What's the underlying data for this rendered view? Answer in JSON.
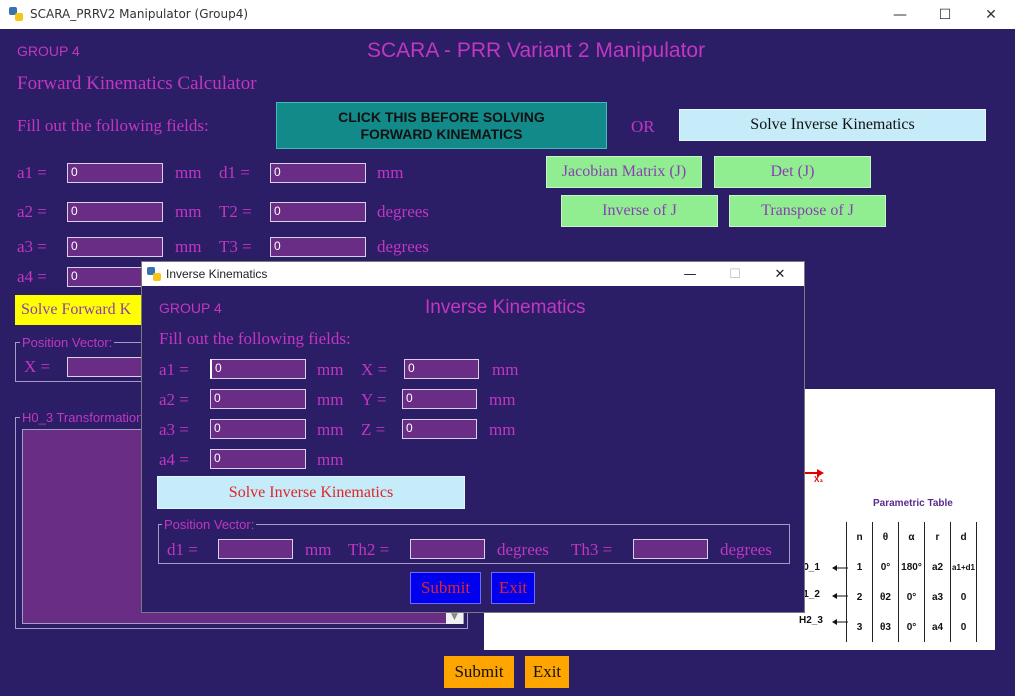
{
  "window": {
    "title": "SCARA_PRRV2 Manipulator (Group4)",
    "minimize": "—",
    "maximize": "☐",
    "close": "✕"
  },
  "main": {
    "group_label": "GROUP 4",
    "app_title": "SCARA - PRR Variant 2 Manipulator",
    "section_title": "Forward Kinematics Calculator",
    "fill_prompt": "Fill out the following fields:",
    "click_before_btn": "CLICK THIS BEFORE SOLVING FORWARD KINEMATICS",
    "or_label": "OR",
    "solve_ik_btn": "Solve Inverse Kinematics",
    "jacobian_btn": "Jacobian Matrix (J)",
    "det_btn": "Det (J)",
    "inverse_btn": "Inverse of J",
    "transpose_btn": "Transpose of J",
    "solve_fk_btn": "Solve Forward K",
    "position_vector_legend": "Position Vector:",
    "x_label": "X =",
    "h03_legend": "H0_3 Transformation",
    "submit_btn": "Submit",
    "exit_btn": "Exit",
    "fields": {
      "a1_label": "a1 =",
      "a1_value": "0",
      "a1_unit": "mm",
      "d1_label": "d1 =",
      "d1_value": "0",
      "d1_unit": "mm",
      "a2_label": "a2 =",
      "a2_value": "0",
      "a2_unit": "mm",
      "t2_label": "T2 =",
      "t2_value": "0",
      "t2_unit": "degrees",
      "a3_label": "a3 =",
      "a3_value": "0",
      "a3_unit": "mm",
      "t3_label": "T3 =",
      "t3_value": "0",
      "t3_unit": "degrees",
      "a4_label": "a4 =",
      "a4_value": "0"
    }
  },
  "dialog": {
    "title": "Inverse Kinematics",
    "minimize": "—",
    "maximize": "☐",
    "close": "✕",
    "group_label": "GROUP 4",
    "heading": "Inverse Kinematics",
    "fill_prompt": "Fill out the following fields:",
    "a1_label": "a1 =",
    "a1_value": "0",
    "a1_unit": "mm",
    "x_label": "X =",
    "x_value": "0",
    "x_unit": "mm",
    "a2_label": "a2 =",
    "a2_value": "0",
    "a2_unit": "mm",
    "y_label": "Y =",
    "y_value": "0",
    "y_unit": "mm",
    "a3_label": "a3 =",
    "a3_value": "0",
    "a3_unit": "mm",
    "z_label": "Z =",
    "z_value": "0",
    "z_unit": "mm",
    "a4_label": "a4 =",
    "a4_value": "0",
    "a4_unit": "mm",
    "solve_btn": "Solve Inverse Kinematics",
    "position_vector_legend": "Position Vector:",
    "d1_label": "d1 =",
    "d1_unit": "mm",
    "th2_label": "Th2 =",
    "th2_unit": "degrees",
    "th3_label": "Th3 =",
    "th3_unit": "degrees",
    "submit_btn": "Submit",
    "exit_btn": "Exit"
  },
  "diagram": {
    "axis_label": "X₃",
    "table_title": "Parametric Table",
    "headers": [
      "n",
      "θ",
      "α",
      "r",
      "d"
    ],
    "rows": [
      {
        "frame": "H0_1",
        "n": "1",
        "theta": "0°",
        "alpha": "180°",
        "r": "a2",
        "d": "a1+d1"
      },
      {
        "frame": "H1_2",
        "n": "2",
        "theta": "θ2",
        "alpha": "0°",
        "r": "a3",
        "d": "0"
      },
      {
        "frame": "H2_3",
        "n": "3",
        "theta": "θ3",
        "alpha": "0°",
        "r": "a4",
        "d": "0"
      }
    ]
  },
  "colors": {
    "background": "#2b1e66",
    "label": "#c236c2",
    "field": "#6a2d86",
    "teal_button": "#138a8a",
    "light_blue_button": "#c5ecf8",
    "green_button": "#90ee90",
    "yellow_button": "#ffff00",
    "orange_button": "#ffa500",
    "blue_button": "#0000ee"
  }
}
